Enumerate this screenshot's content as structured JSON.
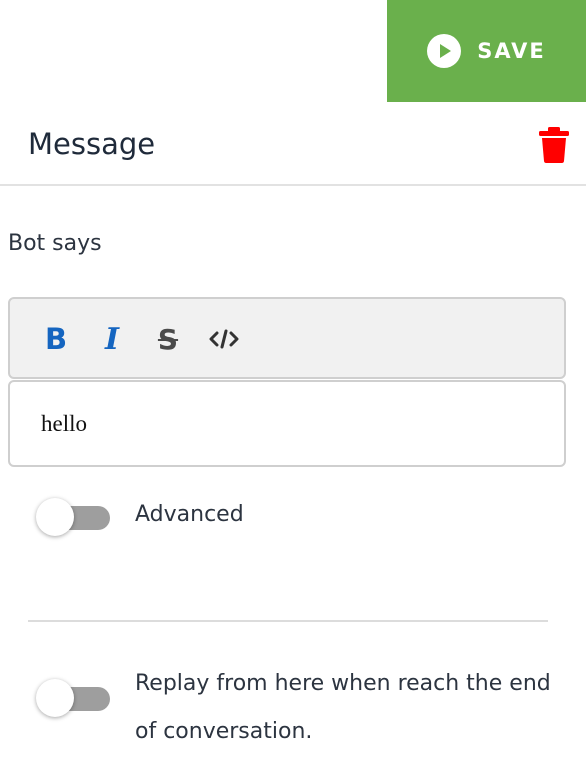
{
  "toolbar_top": {
    "save_label": "SAVE",
    "save_color": "#6ab04c"
  },
  "header": {
    "title": "Message",
    "delete_icon": "trash-icon",
    "delete_color": "#ff0000"
  },
  "editor": {
    "section_label": "Bot says",
    "toolbar": {
      "bold": "B",
      "italic": "I",
      "strikethrough": "S",
      "code_icon": "code-icon"
    },
    "content": "hello"
  },
  "options": {
    "advanced": {
      "label": "Advanced",
      "enabled": false
    },
    "replay": {
      "label": "Replay from here when reach the end of conversation.",
      "enabled": false
    }
  }
}
